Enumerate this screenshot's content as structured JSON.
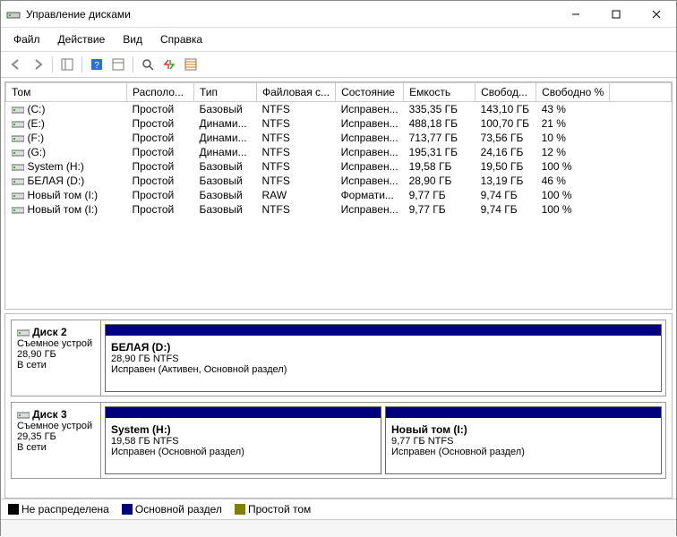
{
  "window": {
    "title": "Управление дисками"
  },
  "menu": {
    "file": "Файл",
    "action": "Действие",
    "view": "Вид",
    "help": "Справка"
  },
  "columns": {
    "volume": "Том",
    "layout": "Располо...",
    "type": "Тип",
    "fs": "Файловая с...",
    "status": "Состояние",
    "capacity": "Емкость",
    "free": "Свобод...",
    "freepct": "Свободно %"
  },
  "volumes": [
    {
      "name": "(C:)",
      "layout": "Простой",
      "type": "Базовый",
      "fs": "NTFS",
      "status": "Исправен...",
      "capacity": "335,35 ГБ",
      "free": "143,10 ГБ",
      "freepct": "43 %"
    },
    {
      "name": "(E:)",
      "layout": "Простой",
      "type": "Динами...",
      "fs": "NTFS",
      "status": "Исправен...",
      "capacity": "488,18 ГБ",
      "free": "100,70 ГБ",
      "freepct": "21 %"
    },
    {
      "name": "(F:)",
      "layout": "Простой",
      "type": "Динами...",
      "fs": "NTFS",
      "status": "Исправен...",
      "capacity": "713,77 ГБ",
      "free": "73,56 ГБ",
      "freepct": "10 %"
    },
    {
      "name": "(G:)",
      "layout": "Простой",
      "type": "Динами...",
      "fs": "NTFS",
      "status": "Исправен...",
      "capacity": "195,31 ГБ",
      "free": "24,16 ГБ",
      "freepct": "12 %"
    },
    {
      "name": "System (H:)",
      "layout": "Простой",
      "type": "Базовый",
      "fs": "NTFS",
      "status": "Исправен...",
      "capacity": "19,58 ГБ",
      "free": "19,50 ГБ",
      "freepct": "100 %"
    },
    {
      "name": "БЕЛАЯ (D:)",
      "layout": "Простой",
      "type": "Базовый",
      "fs": "NTFS",
      "status": "Исправен...",
      "capacity": "28,90 ГБ",
      "free": "13,19 ГБ",
      "freepct": "46 %"
    },
    {
      "name": "Новый том (I:)",
      "layout": "Простой",
      "type": "Базовый",
      "fs": "RAW",
      "status": "Формати...",
      "capacity": "9,77 ГБ",
      "free": "9,74 ГБ",
      "freepct": "100 %"
    },
    {
      "name": "Новый том (I:)",
      "layout": "Простой",
      "type": "Базовый",
      "fs": "NTFS",
      "status": "Исправен...",
      "capacity": "9,77 ГБ",
      "free": "9,74 ГБ",
      "freepct": "100 %"
    }
  ],
  "disks": [
    {
      "label": "Диск 2",
      "kind": "Съемное устрой",
      "size": "28,90 ГБ",
      "state": "В сети",
      "partitions": [
        {
          "title": "БЕЛАЯ  (D:)",
          "sub": "28,90 ГБ NTFS",
          "status": "Исправен (Активен, Основной раздел)"
        }
      ]
    },
    {
      "label": "Диск 3",
      "kind": "Съемное устрой",
      "size": "29,35 ГБ",
      "state": "В сети",
      "partitions": [
        {
          "title": "System  (H:)",
          "sub": "19,58 ГБ NTFS",
          "status": "Исправен (Основной раздел)"
        },
        {
          "title": "Новый том   (I:)",
          "sub": "9,77 ГБ NTFS",
          "status": "Исправен (Основной раздел)"
        }
      ]
    }
  ],
  "legend": {
    "unallocated": "Не распределена",
    "primary": "Основной раздел",
    "simple": "Простой том",
    "colors": {
      "unallocated": "#000000",
      "primary": "#00007f",
      "simple": "#808000"
    }
  }
}
